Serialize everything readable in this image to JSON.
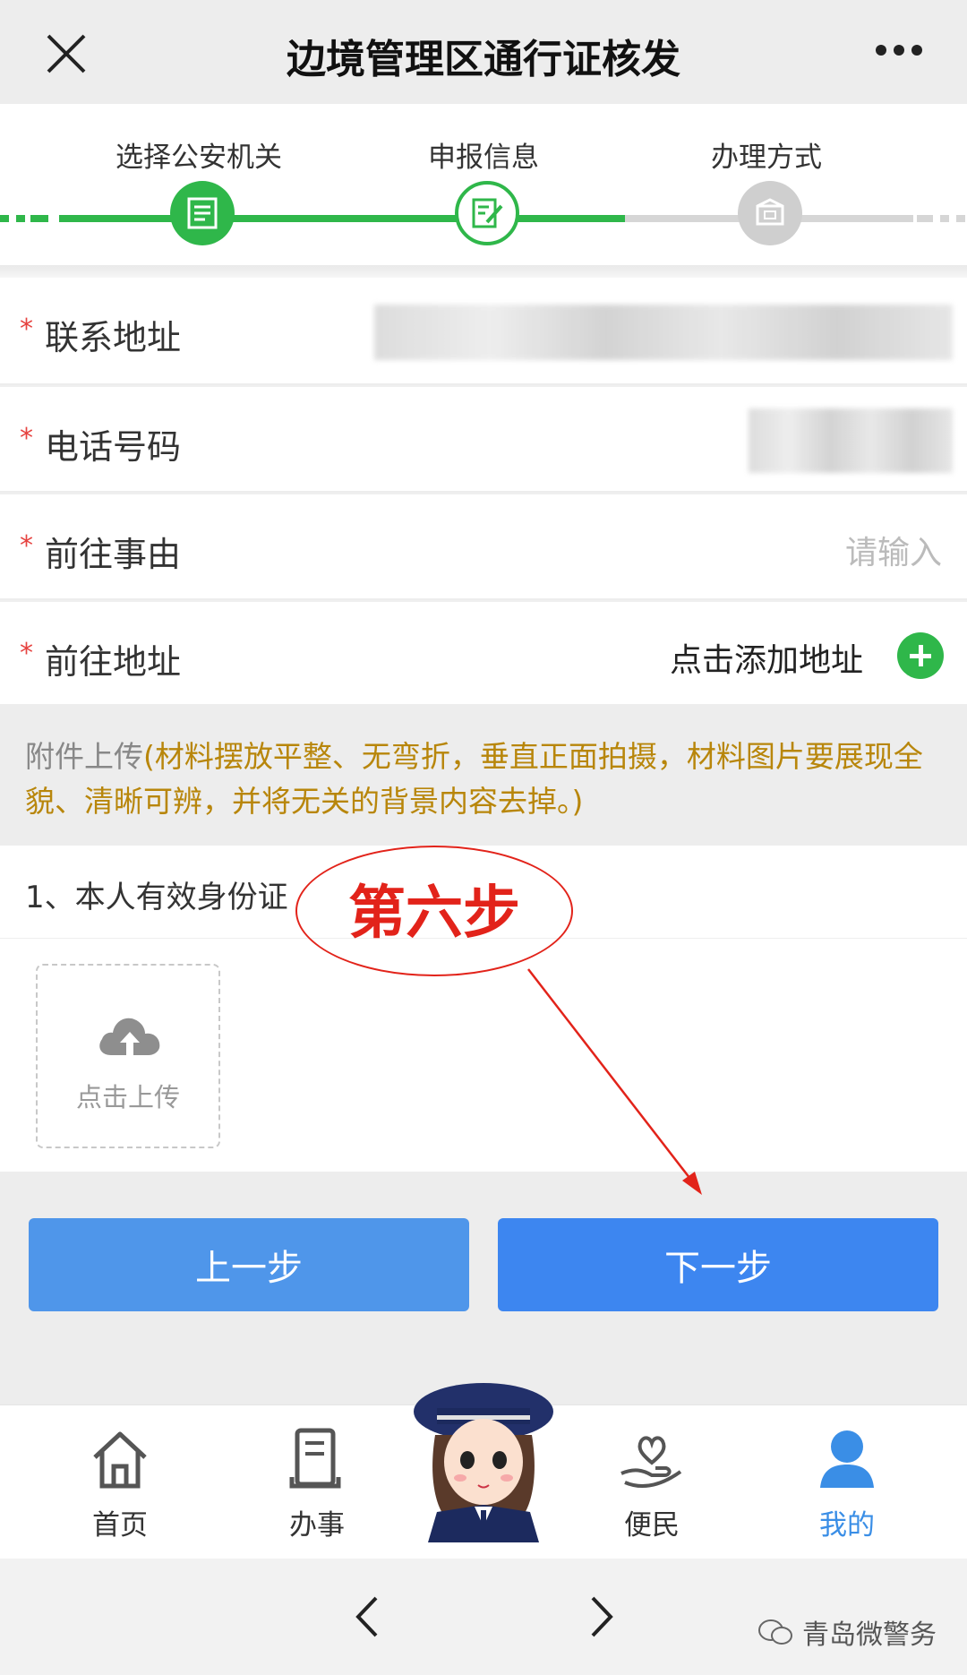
{
  "header": {
    "title": "边境管理区通行证核发",
    "close_icon": "close-icon",
    "more_icon": "more-icon"
  },
  "steps": [
    {
      "label": "选择公安机关",
      "icon": "document-icon",
      "state": "done"
    },
    {
      "label": "申报信息",
      "icon": "edit-icon",
      "state": "current"
    },
    {
      "label": "办理方式",
      "icon": "box-icon",
      "state": "pending"
    }
  ],
  "form": {
    "required_mark": "*",
    "address": {
      "label": "联系地址"
    },
    "phone": {
      "label": "电话号码"
    },
    "reason": {
      "label": "前往事由",
      "placeholder": "请输入"
    },
    "destination": {
      "label": "前往地址",
      "action": "点击添加地址"
    }
  },
  "notice": {
    "prefix": "附件上传",
    "text": "(材料摆放平整、无弯折，垂直正面拍摄，材料图片要展现全貌、清晰可辨，并将无关的背景内容去掉。)"
  },
  "upload": {
    "item_title": "1、本人有效身份证",
    "button": "点击上传"
  },
  "annotation": {
    "text": "第六步"
  },
  "buttons": {
    "prev": "上一步",
    "next": "下一步"
  },
  "tabbar": [
    {
      "label": "首页",
      "icon": "home-icon"
    },
    {
      "label": "办事",
      "icon": "scroll-icon"
    },
    {
      "label": "便民",
      "icon": "heart-hand-icon"
    },
    {
      "label": "我的",
      "icon": "user-icon",
      "active": true
    }
  ],
  "watermark": "青岛微警务",
  "colors": {
    "green": "#2fb74a",
    "blue": "#3d86f0",
    "red": "#e2231a",
    "required": "#e64340"
  }
}
